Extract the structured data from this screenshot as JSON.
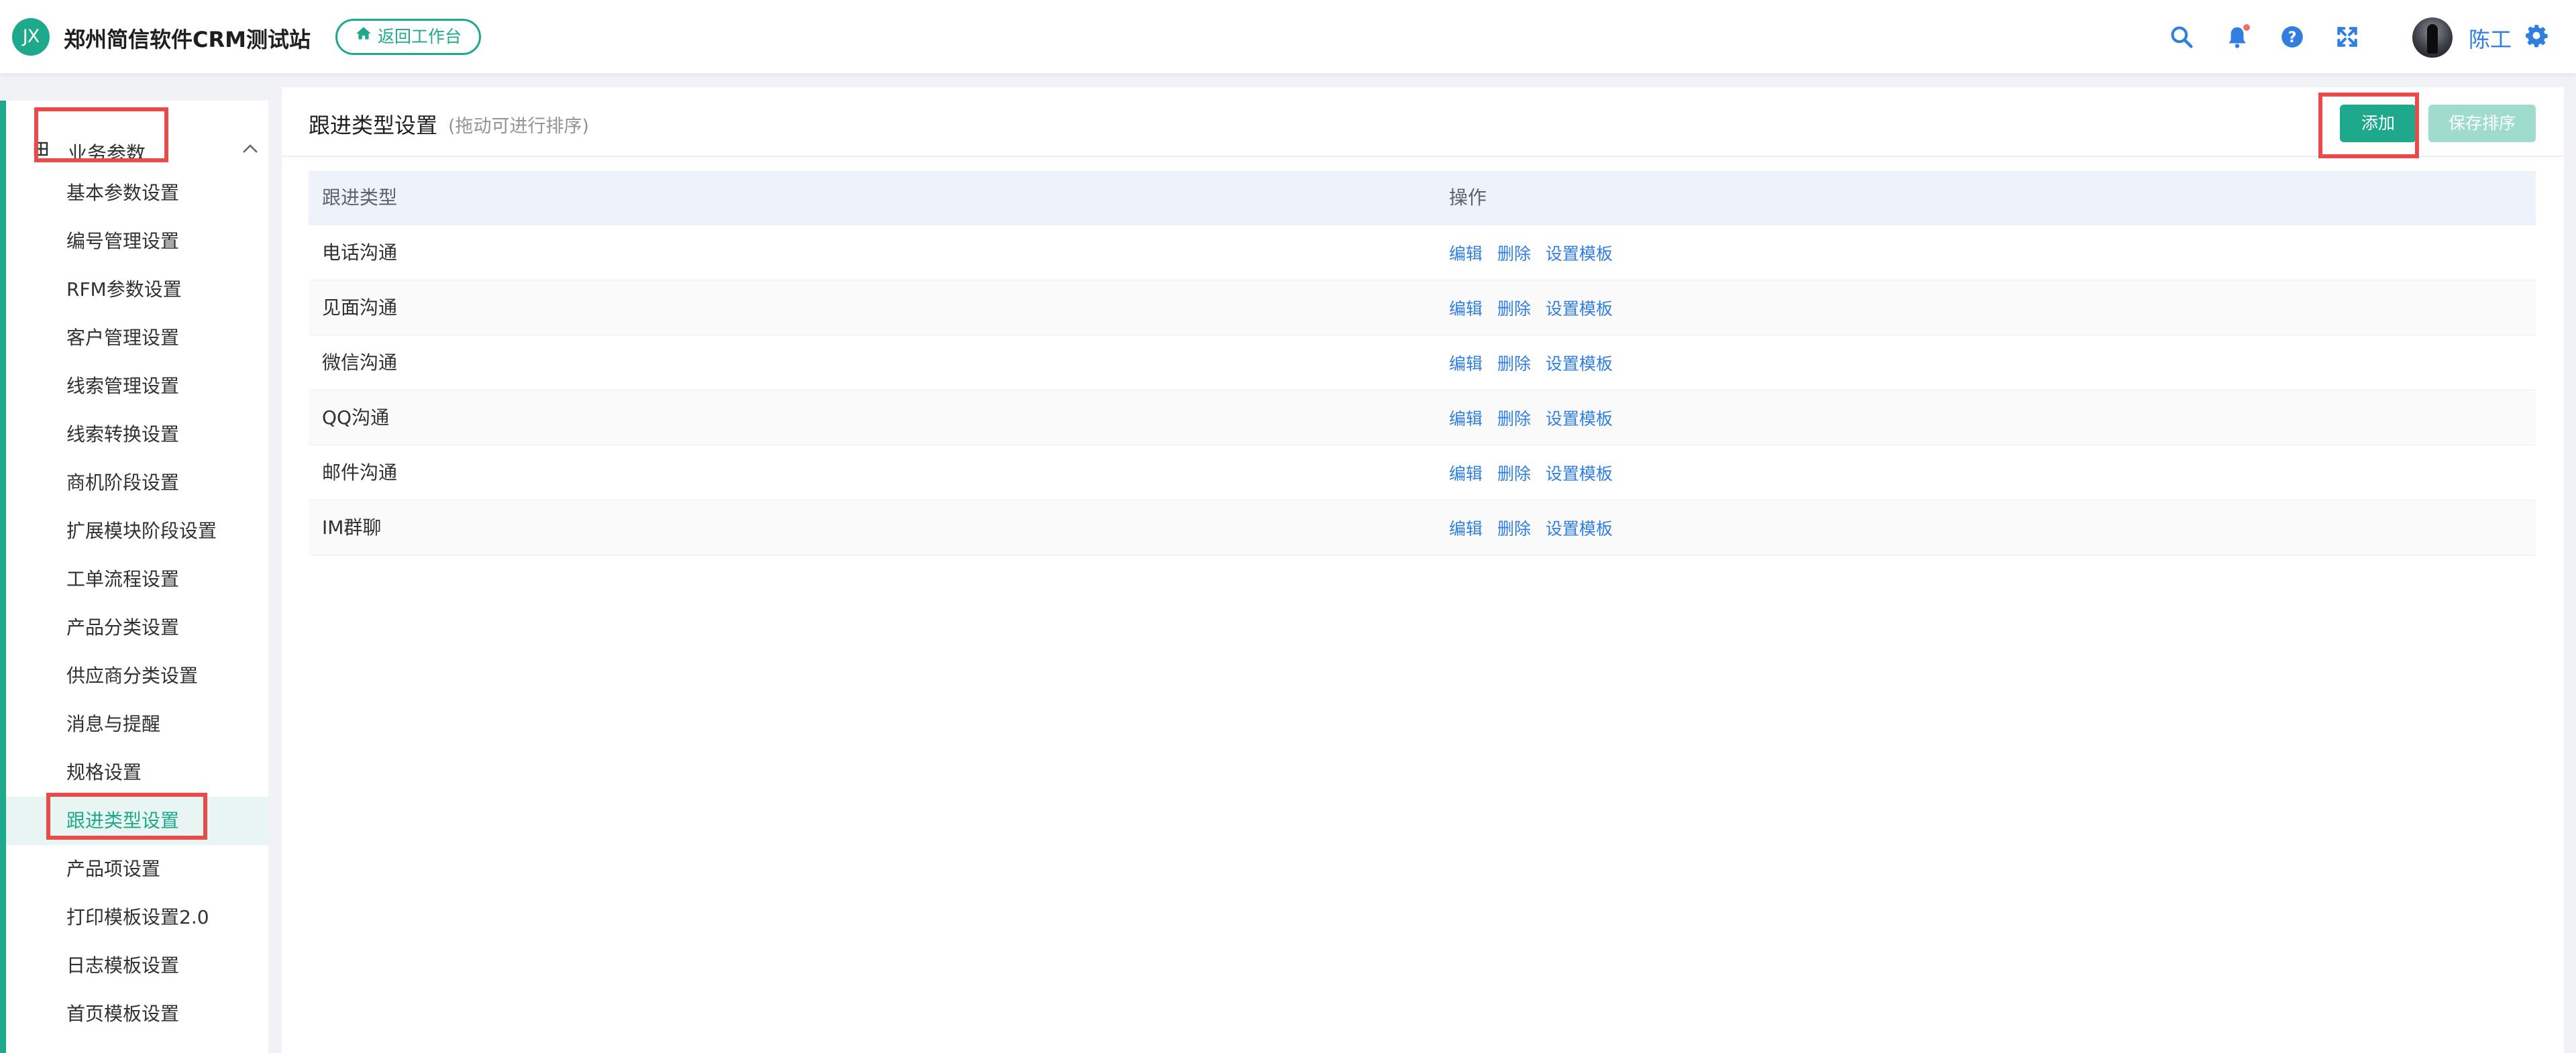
{
  "header": {
    "logo_text": "JX",
    "site_title": "郑州简信软件CRM测试站",
    "back_button_label": "返回工作台",
    "user_name": "陈工",
    "accent_color": "#1fa98c",
    "icons": [
      "search-icon",
      "bell-icon",
      "help-icon",
      "fullscreen-icon",
      "gear-icon"
    ]
  },
  "sidebar": {
    "group_label": "业务参数",
    "items": [
      {
        "label": "基本参数设置"
      },
      {
        "label": "编号管理设置"
      },
      {
        "label": "RFM参数设置"
      },
      {
        "label": "客户管理设置"
      },
      {
        "label": "线索管理设置"
      },
      {
        "label": "线索转换设置"
      },
      {
        "label": "商机阶段设置"
      },
      {
        "label": "扩展模块阶段设置"
      },
      {
        "label": "工单流程设置"
      },
      {
        "label": "产品分类设置"
      },
      {
        "label": "供应商分类设置"
      },
      {
        "label": "消息与提醒"
      },
      {
        "label": "规格设置"
      },
      {
        "label": "跟进类型设置",
        "active": true
      },
      {
        "label": "产品项设置"
      },
      {
        "label": "打印模板设置2.0"
      },
      {
        "label": "日志模板设置"
      },
      {
        "label": "首页模板设置"
      }
    ]
  },
  "main": {
    "title": "跟进类型设置",
    "subtitle": "(拖动可进行排序)",
    "add_label": "添加",
    "save_sort_label": "保存排序",
    "columns": [
      "跟进类型",
      "操作"
    ],
    "actions": [
      "编辑",
      "删除",
      "设置模板"
    ],
    "rows": [
      {
        "name": "电话沟通"
      },
      {
        "name": "见面沟通"
      },
      {
        "name": "微信沟通"
      },
      {
        "name": "QQ沟通"
      },
      {
        "name": "邮件沟通"
      },
      {
        "name": "IM群聊"
      }
    ]
  }
}
